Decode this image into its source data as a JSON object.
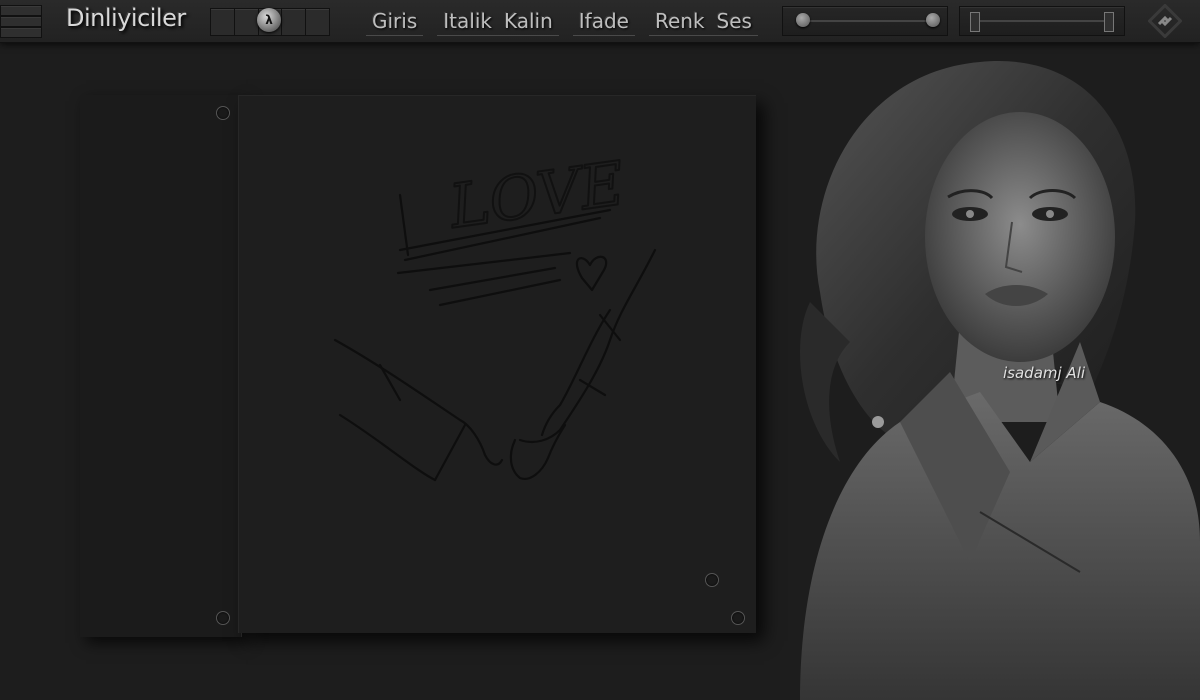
{
  "app": {
    "title": "Dinliyiciler"
  },
  "toolbar": {
    "knob_label": "λ",
    "nav": [
      "Giris",
      "Italik",
      "Kalin",
      "Ifade",
      "Renk",
      "Ses"
    ]
  },
  "volume_slider": {
    "value": 1.0
  },
  "range_slider": {
    "start": 0.0,
    "end": 1.0
  },
  "artwork": {
    "sketch_text": "LOVE",
    "signature": "isadamj Ali"
  },
  "colors": {
    "background": "#1d1d1d",
    "toolbar": "#262626",
    "text": "#cfcfcf"
  }
}
